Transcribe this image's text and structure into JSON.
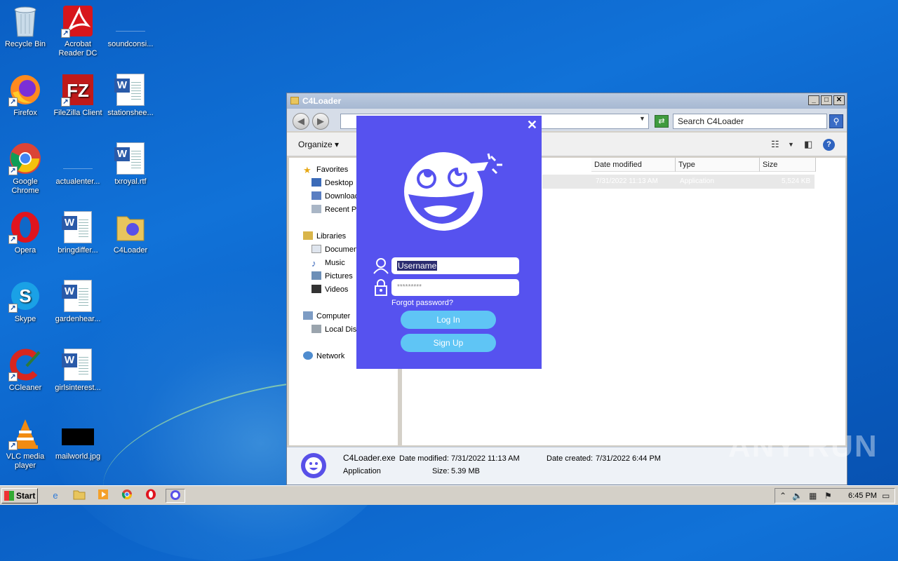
{
  "desktop": {
    "icons": [
      {
        "label": "Recycle Bin"
      },
      {
        "label": "Acrobat Reader DC"
      },
      {
        "label": "soundconsi..."
      },
      {
        "label": "Firefox"
      },
      {
        "label": "FileZilla Client"
      },
      {
        "label": "stationshee..."
      },
      {
        "label": "Google Chrome"
      },
      {
        "label": "actualenter..."
      },
      {
        "label": "txroyal.rtf"
      },
      {
        "label": "Opera"
      },
      {
        "label": "bringdiffer..."
      },
      {
        "label": "C4Loader"
      },
      {
        "label": "Skype"
      },
      {
        "label": "gardenhear..."
      },
      {
        "label": "CCleaner"
      },
      {
        "label": "girlsinterest..."
      },
      {
        "label": "VLC media player"
      },
      {
        "label": "mailworld.jpg"
      }
    ]
  },
  "explorer": {
    "title": "C4Loader",
    "search_placeholder": "Search C4Loader",
    "toolbar": {
      "organize_label": "Organize"
    },
    "nav": {
      "favorites": "Favorites",
      "desktop": "Desktop",
      "downloads": "Downloads",
      "recent": "Recent Places",
      "libraries": "Libraries",
      "documents": "Documents",
      "music": "Music",
      "pictures": "Pictures",
      "videos": "Videos",
      "computer": "Computer",
      "local_disk": "Local Disk",
      "network": "Network"
    },
    "columns": {
      "date_modified": "Date modified",
      "type": "Type",
      "size": "Size"
    },
    "file": {
      "date": "7/31/2022 11:13 AM",
      "type": "Application",
      "size": "5,524 KB"
    },
    "details": {
      "filename": "C4Loader.exe",
      "filetype": "Application",
      "date_modified_label": "Date modified:",
      "date_modified": "7/31/2022 11:13 AM",
      "size_label": "Size:",
      "size": "5.39 MB",
      "date_created_label": "Date created:",
      "date_created": "7/31/2022 6:44 PM"
    }
  },
  "loader": {
    "close": "✕",
    "username_value": "Username",
    "password_value": "*********",
    "forgot": "Forgot password?",
    "login": "Log In",
    "signup": "Sign Up",
    "accent": "#5652ef",
    "button_color": "#5fc5f5"
  },
  "taskbar": {
    "start_label": "Start",
    "clock": "6:45 PM"
  },
  "watermark": "ANY RUN"
}
